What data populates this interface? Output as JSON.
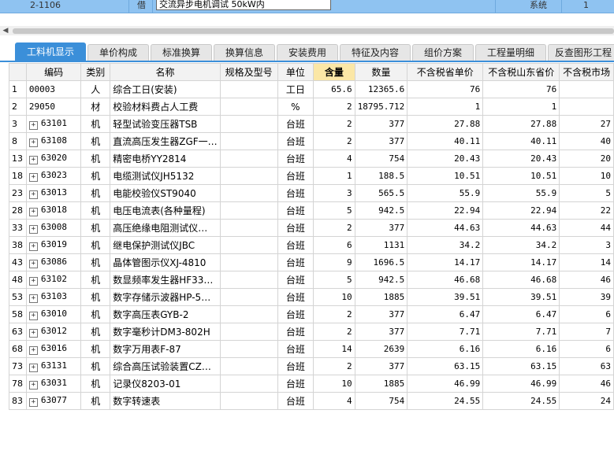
{
  "top_row": {
    "code": "2-1106",
    "type": "借",
    "name": "交流异步电机调试 50kW内",
    "category": "系统",
    "qty": "1"
  },
  "scroll_left_icon": "triangle-left-icon",
  "tabs": [
    {
      "label": "工料机显示",
      "active": true
    },
    {
      "label": "单价构成"
    },
    {
      "label": "标准换算"
    },
    {
      "label": "换算信息"
    },
    {
      "label": "安装费用"
    },
    {
      "label": "特征及内容"
    },
    {
      "label": "组价方案"
    },
    {
      "label": "工程量明细"
    },
    {
      "label": "反查图形工程"
    }
  ],
  "columns": [
    "编码",
    "类别",
    "名称",
    "规格及型号",
    "单位",
    "含量",
    "数量",
    "不含税省单价",
    "不含税山东省价",
    "不含税市场"
  ],
  "rows": [
    {
      "no": "1",
      "exp": false,
      "code": "00003",
      "type": "人",
      "name": "综合工日(安装)",
      "spec": "",
      "unit": "工日",
      "content": "65.6",
      "qty": "12365.6",
      "p1": "76",
      "p2": "76",
      "p3": ""
    },
    {
      "no": "2",
      "exp": false,
      "code": "29050",
      "type": "材",
      "name": "校验材料费占人工费",
      "spec": "",
      "unit": "%",
      "content": "2",
      "qty": "18795.712",
      "p1": "1",
      "p2": "1",
      "p3": ""
    },
    {
      "no": "3",
      "exp": true,
      "code": "63101",
      "type": "机",
      "name": "轻型试验变压器TSB",
      "spec": "",
      "unit": "台班",
      "content": "2",
      "qty": "377",
      "p1": "27.88",
      "p2": "27.88",
      "p3": "27"
    },
    {
      "no": "8",
      "exp": true,
      "code": "63108",
      "type": "机",
      "name": "直流高压发生器ZGF一…",
      "spec": "",
      "unit": "台班",
      "content": "2",
      "qty": "377",
      "p1": "40.11",
      "p2": "40.11",
      "p3": "40"
    },
    {
      "no": "13",
      "exp": true,
      "code": "63020",
      "type": "机",
      "name": "精密电桥YY2814",
      "spec": "",
      "unit": "台班",
      "content": "4",
      "qty": "754",
      "p1": "20.43",
      "p2": "20.43",
      "p3": "20"
    },
    {
      "no": "18",
      "exp": true,
      "code": "63023",
      "type": "机",
      "name": "电缆测试仪JH5132",
      "spec": "",
      "unit": "台班",
      "content": "1",
      "qty": "188.5",
      "p1": "10.51",
      "p2": "10.51",
      "p3": "10"
    },
    {
      "no": "23",
      "exp": true,
      "code": "63013",
      "type": "机",
      "name": "电能校验仪ST9040",
      "spec": "",
      "unit": "台班",
      "content": "3",
      "qty": "565.5",
      "p1": "55.9",
      "p2": "55.9",
      "p3": "5"
    },
    {
      "no": "28",
      "exp": true,
      "code": "63018",
      "type": "机",
      "name": "电压电流表(各种量程)",
      "spec": "",
      "unit": "台班",
      "content": "5",
      "qty": "942.5",
      "p1": "22.94",
      "p2": "22.94",
      "p3": "22"
    },
    {
      "no": "33",
      "exp": true,
      "code": "63008",
      "type": "机",
      "name": "高压绝缘电阻测试仪…",
      "spec": "",
      "unit": "台班",
      "content": "2",
      "qty": "377",
      "p1": "44.63",
      "p2": "44.63",
      "p3": "44"
    },
    {
      "no": "38",
      "exp": true,
      "code": "63019",
      "type": "机",
      "name": "继电保护测试仪JBC",
      "spec": "",
      "unit": "台班",
      "content": "6",
      "qty": "1131",
      "p1": "34.2",
      "p2": "34.2",
      "p3": "3"
    },
    {
      "no": "43",
      "exp": true,
      "code": "63086",
      "type": "机",
      "name": "晶体管图示仪XJ-4810",
      "spec": "",
      "unit": "台班",
      "content": "9",
      "qty": "1696.5",
      "p1": "14.17",
      "p2": "14.17",
      "p3": "14"
    },
    {
      "no": "48",
      "exp": true,
      "code": "63102",
      "type": "机",
      "name": "数显频率发生器HF33…",
      "spec": "",
      "unit": "台班",
      "content": "5",
      "qty": "942.5",
      "p1": "46.68",
      "p2": "46.68",
      "p3": "46"
    },
    {
      "no": "53",
      "exp": true,
      "code": "63103",
      "type": "机",
      "name": "数字存储示波器HP-5…",
      "spec": "",
      "unit": "台班",
      "content": "10",
      "qty": "1885",
      "p1": "39.51",
      "p2": "39.51",
      "p3": "39"
    },
    {
      "no": "58",
      "exp": true,
      "code": "63010",
      "type": "机",
      "name": "数字高压表GYB-2",
      "spec": "",
      "unit": "台班",
      "content": "2",
      "qty": "377",
      "p1": "6.47",
      "p2": "6.47",
      "p3": "6"
    },
    {
      "no": "63",
      "exp": true,
      "code": "63012",
      "type": "机",
      "name": "数字毫秒计DM3-802H",
      "spec": "",
      "unit": "台班",
      "content": "2",
      "qty": "377",
      "p1": "7.71",
      "p2": "7.71",
      "p3": "7"
    },
    {
      "no": "68",
      "exp": true,
      "code": "63016",
      "type": "机",
      "name": "数字万用表F-87",
      "spec": "",
      "unit": "台班",
      "content": "14",
      "qty": "2639",
      "p1": "6.16",
      "p2": "6.16",
      "p3": "6"
    },
    {
      "no": "73",
      "exp": true,
      "code": "63131",
      "type": "机",
      "name": "综合高压试验装置CZ…",
      "spec": "",
      "unit": "台班",
      "content": "2",
      "qty": "377",
      "p1": "63.15",
      "p2": "63.15",
      "p3": "63"
    },
    {
      "no": "78",
      "exp": true,
      "code": "63031",
      "type": "机",
      "name": "记录仪8203-01",
      "spec": "",
      "unit": "台班",
      "content": "10",
      "qty": "1885",
      "p1": "46.99",
      "p2": "46.99",
      "p3": "46"
    },
    {
      "no": "83",
      "exp": true,
      "code": "63077",
      "type": "机",
      "name": "数字转速表",
      "spec": "",
      "unit": "台班",
      "content": "4",
      "qty": "754",
      "p1": "24.55",
      "p2": "24.55",
      "p3": "24"
    }
  ]
}
